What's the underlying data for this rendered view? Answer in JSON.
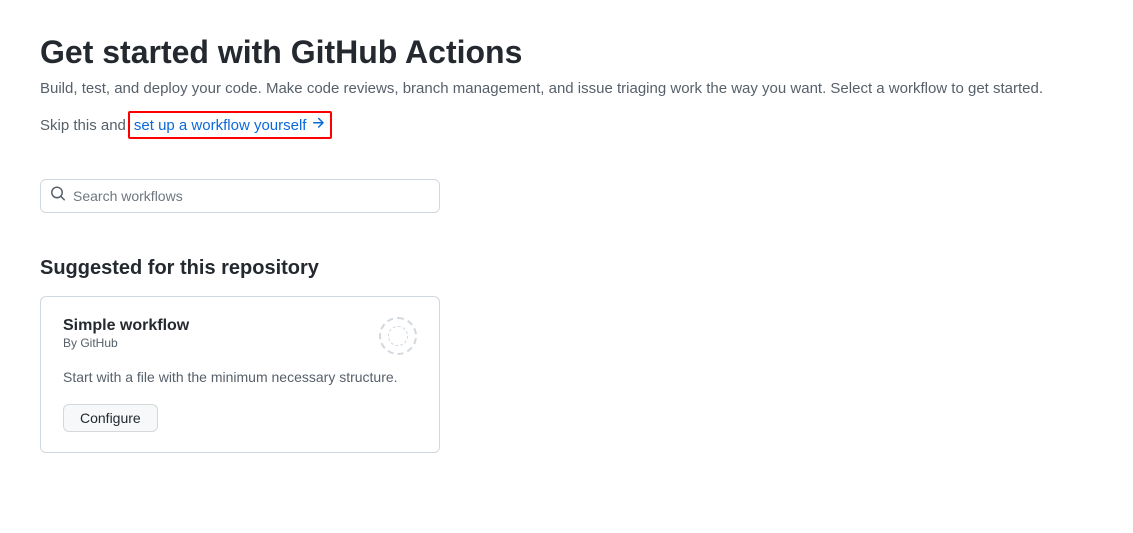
{
  "header": {
    "title": "Get started with GitHub Actions",
    "subtitle": "Build, test, and deploy your code. Make code reviews, branch management, and issue triaging work the way you want. Select a workflow to get started.",
    "skip_prefix": "Skip this and",
    "setup_link": "set up a workflow yourself"
  },
  "search": {
    "placeholder": "Search workflows"
  },
  "suggested": {
    "heading": "Suggested for this repository",
    "card": {
      "title": "Simple workflow",
      "author": "By GitHub",
      "description": "Start with a file with the minimum necessary structure.",
      "button": "Configure"
    }
  }
}
